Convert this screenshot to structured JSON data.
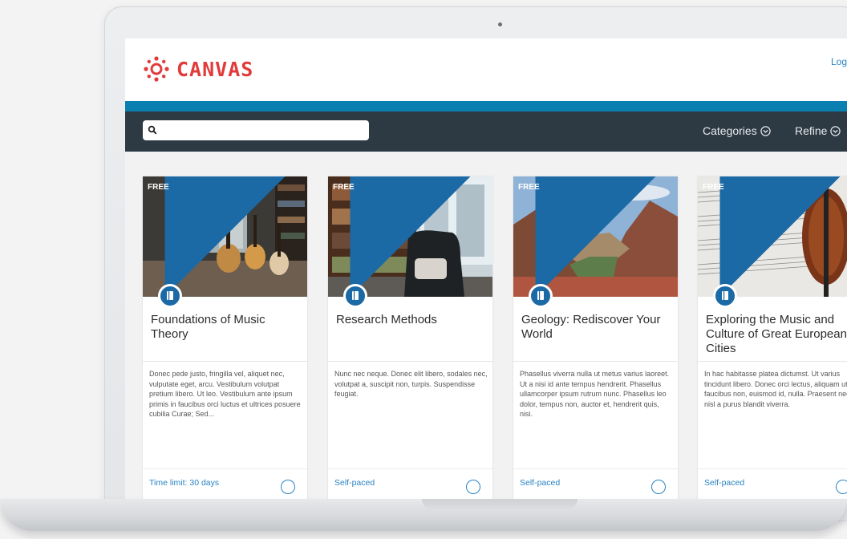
{
  "header": {
    "logo_text": "CANVAS",
    "login_label": "Log",
    "accent_color": "#e23a3a"
  },
  "toolbar": {
    "search_placeholder": "",
    "categories_label": "Categories",
    "refine_label": "Refine"
  },
  "cards": [
    {
      "badge": "FREE",
      "title": "Foundations of Music Theory",
      "description": "Donec pede justo, fringilla vel, aliquet nec, vulputate eget, arcu. Vestibulum volutpat pretium libero. Ut leo. Vestibulum ante ipsum primis in faucibus orci luctus et ultrices posuere cubilia Curae; Sed...",
      "footer": "Time limit: 30 days",
      "image": "music-room-guitars"
    },
    {
      "badge": "FREE",
      "title": "Research Methods",
      "description": "Nunc nec neque. Donec elit libero, sodales nec, volutpat a, suscipit non, turpis. Suspendisse feugiat.",
      "footer": "Self-paced",
      "image": "library-bookshelves-chair"
    },
    {
      "badge": "FREE",
      "title": "Geology: Rediscover Your World",
      "description": "Phasellus viverra nulla ut metus varius laoreet. Ut a nisi id ante tempus hendrerit. Phasellus ullamcorper ipsum rutrum nunc. Phasellus leo dolor, tempus non, auctor et, hendrerit quis, nisi.",
      "footer": "Self-paced",
      "image": "canyon-landscape"
    },
    {
      "badge": "FREE",
      "title": "Exploring the Music and Culture of Great European Cities",
      "description": "In hac habitasse platea dictumst. Ut varius tincidunt libero. Donec orci lectus, aliquam ut, faucibus non, euismod id, nulla. Praesent nec nisl a purus blandit viverra.",
      "footer": "Self-paced",
      "image": "sheet-music-violin"
    }
  ]
}
